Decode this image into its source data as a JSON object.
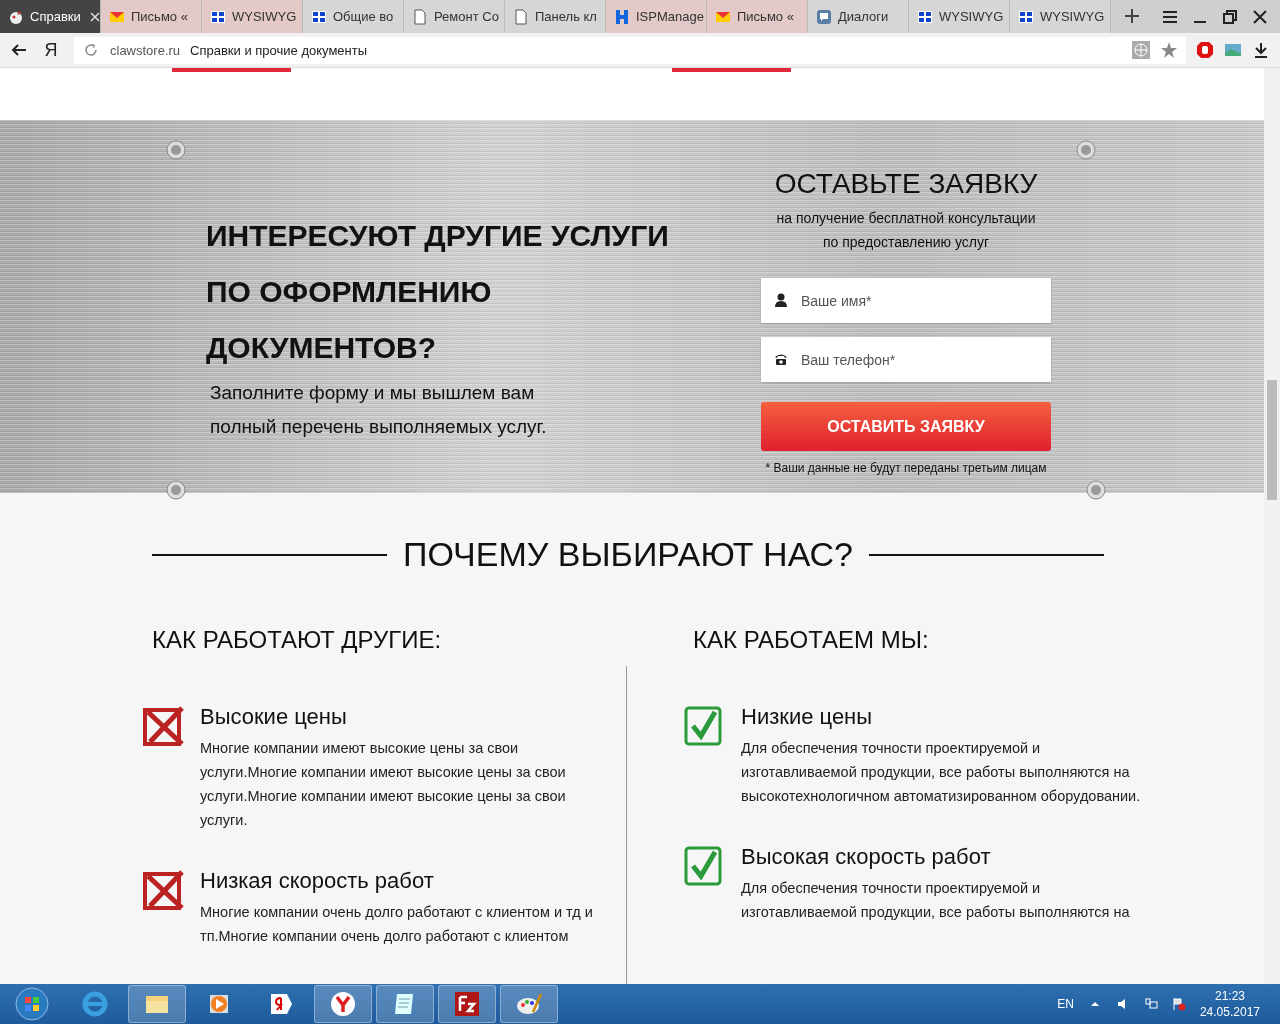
{
  "browser": {
    "tabs": [
      {
        "kind": "bird",
        "label": "Справки",
        "selected": true
      },
      {
        "kind": "mail",
        "label": "Письмо «",
        "selected": false
      },
      {
        "kind": "wbru",
        "label": "WYSIWYG",
        "selected": false
      },
      {
        "kind": "wbru",
        "label": "Общие во",
        "selected": false
      },
      {
        "kind": "doc",
        "label": "Ремонт Со",
        "selected": false
      },
      {
        "kind": "doc",
        "label": "Панель кл",
        "selected": false
      },
      {
        "kind": "isp",
        "label": "ISPManage",
        "selected": false
      },
      {
        "kind": "mail",
        "label": "Письмо «",
        "selected": false
      },
      {
        "kind": "chat",
        "label": "Диалоги",
        "selected": false
      },
      {
        "kind": "wbru",
        "label": "WYSIWYG",
        "selected": false
      },
      {
        "kind": "wbru",
        "label": "WYSIWYG",
        "selected": false
      }
    ],
    "logo": "Я",
    "address": {
      "domain": "clawstore.ru",
      "title": "Справки и прочие документы"
    }
  },
  "promo": {
    "heading": "ИНТЕРЕСУЮТ ДРУГИЕ УСЛУГИ ПО ОФОРМЛЕНИЮ ДОКУМЕНТОВ?",
    "text": "Заполните форму и мы вышлем вам полный перечень выполняемых услуг.",
    "form": {
      "title": "ОСТАВЬТЕ ЗАЯВКУ",
      "subtitle": "на получение бесплатной консультации по предоставлению услуг",
      "fields": [
        {
          "kind": "person",
          "placeholder": "Ваше имя*"
        },
        {
          "kind": "phone",
          "placeholder": "Ваш телефон*"
        }
      ],
      "submit": "ОСТАВИТЬ ЗАЯВКУ",
      "note": "* Ваши данные не будут переданы третьим лицам"
    }
  },
  "why": {
    "title": "ПОЧЕМУ ВЫБИРАЮТ НАС?",
    "columns": [
      {
        "heading": "КАК РАБОТАЮТ ДРУГИЕ:",
        "kind": "cross",
        "items": [
          {
            "title": "Высокие цены",
            "text": "Многие компании имеют высокие цены за свои услуги.Многие компании имеют высокие цены за свои услуги.Многие компании имеют высокие цены за свои услуги."
          },
          {
            "title": "Низкая скорость работ",
            "text": "Многие компании очень долго работают с клиентом и тд и тп.Многие компании очень долго работают с клиентом"
          }
        ]
      },
      {
        "heading": "КАК РАБОТАЕМ МЫ:",
        "kind": "check",
        "items": [
          {
            "title": "Низкие цены",
            "text": "Для обеспечения точности проектируемой и изготавливаемой продукции, все работы выполняются на высокотехнологичном автоматизированном оборудовании."
          },
          {
            "title": "Высокая скорость работ",
            "text": "Для обеспечения точности проектируемой и изготавливаемой продукции, все работы выполняются на"
          }
        ]
      }
    ]
  },
  "taskbar": {
    "language": "EN",
    "time": "21:23",
    "date": "24.05.2017"
  }
}
